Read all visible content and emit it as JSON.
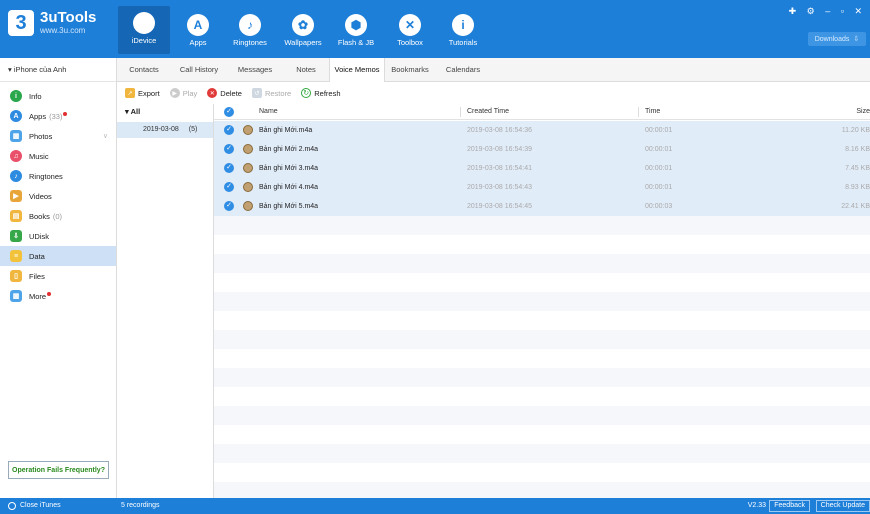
{
  "app": {
    "name": "3uTools",
    "logo_mark": "3",
    "url": "www.3u.com",
    "downloads_label": "Downloads",
    "window_controls": "✚ ⚙ – ▫ ✕"
  },
  "nav": [
    {
      "label": "iDevice",
      "icon": "apple-icon",
      "glyph": ""
    },
    {
      "label": "Apps",
      "icon": "app-store-icon",
      "glyph": "A"
    },
    {
      "label": "Ringtones",
      "icon": "bell-icon",
      "glyph": "♪"
    },
    {
      "label": "Wallpapers",
      "icon": "wallpaper-icon",
      "glyph": "✿"
    },
    {
      "label": "Flash & JB",
      "icon": "flash-icon",
      "glyph": "⬢"
    },
    {
      "label": "Toolbox",
      "icon": "toolbox-icon",
      "glyph": "✕"
    },
    {
      "label": "Tutorials",
      "icon": "info-icon",
      "glyph": "i"
    }
  ],
  "sidebar": {
    "device": "iPhone của Anh",
    "items": [
      {
        "label": "Info",
        "count": "",
        "dot": false
      },
      {
        "label": "Apps",
        "count": "(33)",
        "dot": true
      },
      {
        "label": "Photos",
        "count": "",
        "dot": false
      },
      {
        "label": "Music",
        "count": "",
        "dot": false
      },
      {
        "label": "Ringtones",
        "count": "",
        "dot": false
      },
      {
        "label": "Videos",
        "count": "",
        "dot": false
      },
      {
        "label": "Books",
        "count": "(0)",
        "dot": false
      },
      {
        "label": "UDisk",
        "count": "",
        "dot": false
      },
      {
        "label": "Data",
        "count": "",
        "dot": false
      },
      {
        "label": "Files",
        "count": "",
        "dot": false
      },
      {
        "label": "More",
        "count": "",
        "dot": true
      }
    ],
    "operation_fails": "Operation Fails Frequently?"
  },
  "tabs": [
    "Contacts",
    "Call History",
    "Messages",
    "Notes",
    "Voice Memos",
    "Bookmarks",
    "Calendars"
  ],
  "toolbar": {
    "export": "Export",
    "play": "Play",
    "delete": "Delete",
    "restore": "Restore",
    "refresh": "Refresh"
  },
  "tree": {
    "all": "All",
    "node_date": "2019-03-08",
    "node_count": "(5)"
  },
  "table": {
    "headers": {
      "name": "Name",
      "created": "Created Time",
      "time": "Time",
      "size": "Size"
    },
    "rows": [
      {
        "name": "Bản ghi Mới.m4a",
        "created": "2019-03-08 16:54:36",
        "time": "00:00:01",
        "size": "11.20 KB"
      },
      {
        "name": "Bản ghi Mới 2.m4a",
        "created": "2019-03-08 16:54:39",
        "time": "00:00:01",
        "size": "8.16 KB"
      },
      {
        "name": "Bản ghi Mới 3.m4a",
        "created": "2019-03-08 16:54:41",
        "time": "00:00:01",
        "size": "7.45 KB"
      },
      {
        "name": "Bản ghi Mới 4.m4a",
        "created": "2019-03-08 16:54:43",
        "time": "00:00:01",
        "size": "8.93 KB"
      },
      {
        "name": "Bản ghi Mới 5.m4a",
        "created": "2019-03-08 16:54:45",
        "time": "00:00:03",
        "size": "22.41 KB"
      }
    ]
  },
  "status": {
    "close_itunes": "Close iTunes",
    "recordings": "5 recordings",
    "version": "V2.33",
    "feedback": "Feedback",
    "check_update": "Check Update"
  },
  "colors": {
    "brand": "#1e7fd8",
    "selected_row": "#e1ecf9",
    "link_green": "#2a8a1f"
  }
}
